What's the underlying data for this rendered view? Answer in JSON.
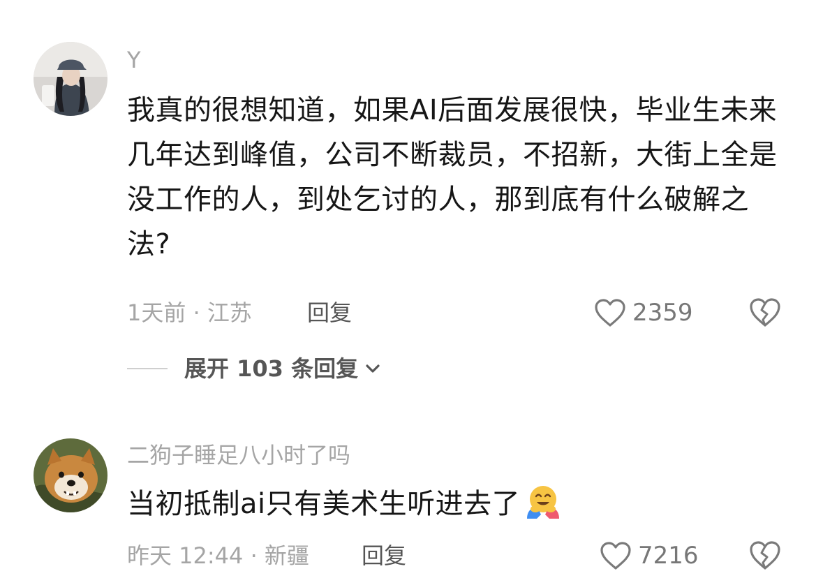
{
  "comments": [
    {
      "username": "Y",
      "text": "我真的很想知道，如果AI后面发展很快，毕业生未来几年达到峰值，公司不断裁员，不招新，大街上全是没工作的人，到处乞讨的人，那到底有什么破解之法?",
      "meta": "1天前 · 江苏",
      "reply_label": "回复",
      "like_count": "2359",
      "expand_label": "展开 103 条回复"
    },
    {
      "username": "二狗子睡足八小时了吗",
      "text": "当初抵制ai只有美术生听进去了",
      "emoji": "hugging-face-emoji",
      "meta": "昨天 12:44 · 新疆",
      "reply_label": "回复",
      "like_count": "7216"
    }
  ],
  "icons": {
    "like": "heart-outline-icon",
    "dislike": "broken-heart-icon",
    "expand": "chevron-down-icon"
  },
  "colors": {
    "text_primary": "#161616",
    "text_secondary": "#a5a5a5",
    "text_action": "#555555"
  }
}
